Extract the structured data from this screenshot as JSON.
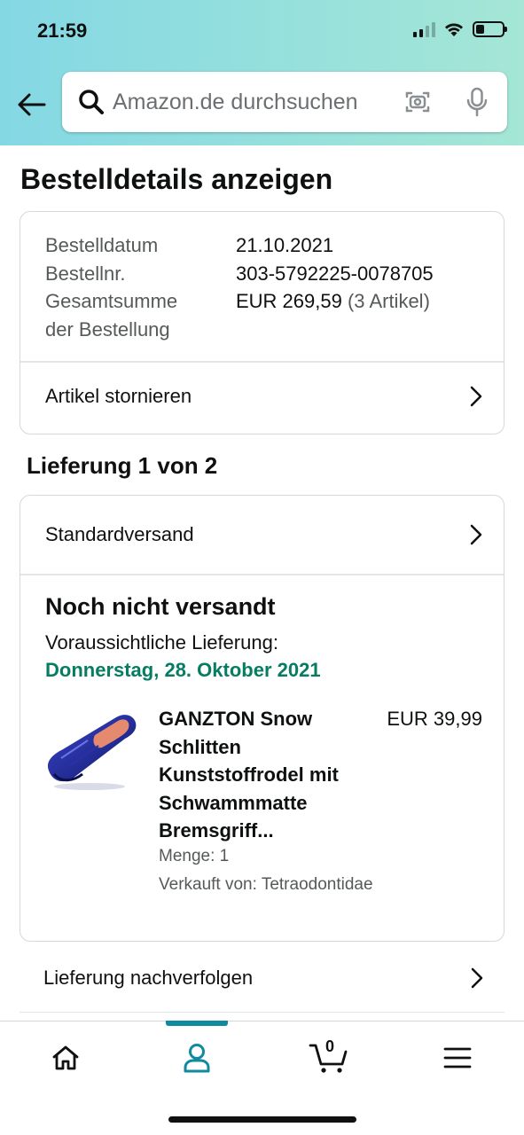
{
  "status_bar": {
    "time": "21:59",
    "icons": [
      "signal-icon",
      "wifi-icon",
      "battery-icon"
    ]
  },
  "search": {
    "placeholder": "Amazon.de durchsuchen",
    "value": ""
  },
  "icons": {
    "back": "back-arrow-icon",
    "search": "search-icon",
    "camera": "camera-icon",
    "mic": "microphone-icon"
  },
  "page": {
    "title": "Bestelldetails anzeigen"
  },
  "order_summary": {
    "date_label": "Bestelldatum",
    "date_value": "21.10.2021",
    "number_label": "Bestellnr.",
    "number_value": "303-5792225-0078705",
    "total_label_line1": "Gesamtsumme",
    "total_label_line2": "der Bestellung",
    "total_value": "EUR 269,59",
    "total_items": "(3 Artikel)",
    "cancel_label": "Artikel stornieren"
  },
  "delivery": {
    "section_title": "Lieferung 1 von 2",
    "shipping_method": "Standardversand",
    "status": "Noch nicht versandt",
    "eta_label": "Voraussichtliche Lieferung:",
    "eta_date": "Donnerstag, 28. Oktober 2021",
    "track_label": "Lieferung nachverfolgen"
  },
  "product": {
    "title_lines": [
      "GANZTON Snow",
      "Schlitten",
      "Kunststoffrodel mit",
      "Schwammmatte",
      "Bremsgriff..."
    ],
    "price": "EUR 39,99",
    "quantity": "Menge: 1",
    "seller": "Verkauft von: Tetraodontidae"
  },
  "bottom_nav": {
    "items": [
      "home-icon",
      "account-icon",
      "cart-icon",
      "menu-icon"
    ],
    "active": "account-icon",
    "cart_count": "0"
  },
  "colors": {
    "header_gradient_start": "#84d8e4",
    "header_gradient_end": "#a5e6d6",
    "eta_green": "#067d62",
    "active_tab": "#0f8a9e"
  }
}
